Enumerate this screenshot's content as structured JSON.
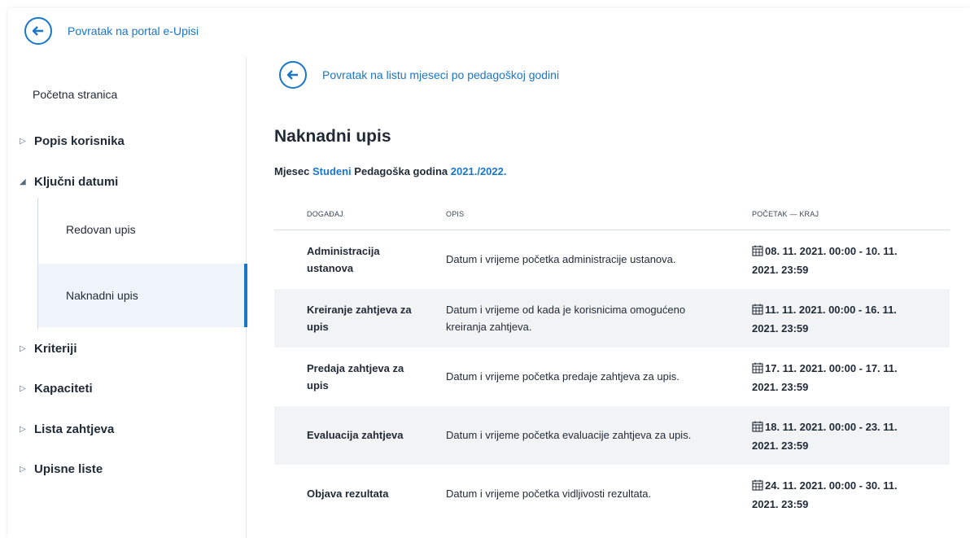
{
  "top_back": {
    "label": "Povratak na portal e-Upisi"
  },
  "sidebar": {
    "home": "Početna stranica",
    "sections": [
      {
        "label": "Popis korisnika",
        "expanded": false
      },
      {
        "label": "Ključni datumi",
        "expanded": true
      },
      {
        "label": "Kriteriji",
        "expanded": false
      },
      {
        "label": "Kapaciteti",
        "expanded": false
      },
      {
        "label": "Lista zahtjeva",
        "expanded": false
      },
      {
        "label": "Upisne liste",
        "expanded": false
      }
    ],
    "sub_items": [
      {
        "label": "Redovan upis",
        "active": false
      },
      {
        "label": "Naknadni upis",
        "active": true
      }
    ]
  },
  "main": {
    "back": {
      "label": "Povratak na listu mjeseci po pedagoškoj godini"
    },
    "title": "Naknadni upis",
    "meta": {
      "month_label": "Mjesec",
      "month_value": "Studeni",
      "year_label": "Pedagoška godina",
      "year_value": "2021./2022."
    },
    "table": {
      "headers": [
        "DOGAĐAJ",
        "OPIS",
        "POČETAK — KRAJ"
      ],
      "rows": [
        {
          "event": [
            "Administracija",
            "ustanova"
          ],
          "desc": [
            "Datum i vrijeme početka administracije ustanova."
          ],
          "dates": [
            "08. 11. 2021. 00:00 - 10. 11.",
            "2021. 23:59"
          ]
        },
        {
          "event": [
            "Kreiranje zahtjeva za",
            "upis"
          ],
          "desc": [
            "Datum i vrijeme od kada je korisnicima omogućeno",
            "kreiranja zahtjeva."
          ],
          "dates": [
            "11. 11. 2021. 00:00 - 16. 11.",
            "2021. 23:59"
          ]
        },
        {
          "event": [
            "Predaja zahtjeva za",
            "upis"
          ],
          "desc": [
            "Datum i vrijeme početka predaje zahtjeva za upis."
          ],
          "dates": [
            "17. 11. 2021. 00:00 - 17. 11.",
            "2021. 23:59"
          ]
        },
        {
          "event": [
            "Evaluacija zahtjeva"
          ],
          "desc": [
            "Datum i vrijeme početka evaluacije zahtjeva za upis."
          ],
          "dates": [
            "18. 11. 2021. 00:00 - 23. 11.",
            "2021. 23:59"
          ]
        },
        {
          "event": [
            "Objava rezultata"
          ],
          "desc": [
            "Datum i vrijeme početka vidljivosti rezultata."
          ],
          "dates": [
            "24. 11. 2021. 00:00 - 30. 11.",
            "2021. 23:59"
          ]
        }
      ]
    }
  },
  "colors": {
    "accent": "#1a76c9",
    "text": "#1f2a36",
    "row_alt": "#f2f3f5",
    "active_bg": "#eff4fa"
  },
  "icons": {
    "back": "arrow-left-icon",
    "calendar": "calendar-icon",
    "collapsed": "triangle-right-icon",
    "expanded": "triangle-down-icon"
  }
}
